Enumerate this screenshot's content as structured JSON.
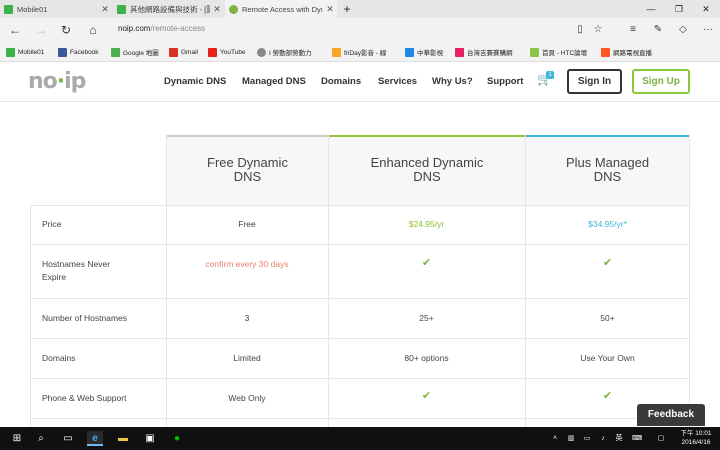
{
  "browser": {
    "tabs": [
      {
        "label": "Mobile01",
        "color": "#3cb34a"
      },
      {
        "label": "其他網路設備與技術 - [圖文",
        "color": "#3cb34a"
      },
      {
        "label": "Remote Access with Dyı",
        "color": "#7cb342"
      }
    ],
    "new_tab": "+",
    "url_host": "noip.com",
    "url_path": "/remote-access"
  },
  "favorites": [
    {
      "label": "Mobile01",
      "color": "#3cb34a"
    },
    {
      "label": "Facebook",
      "color": "#3b5998"
    },
    {
      "label": "Google 地圖",
      "color": "#4caf50"
    },
    {
      "label": "Gmail",
      "color": "#d93025"
    },
    {
      "label": "YouTube",
      "color": "#e62117"
    },
    {
      "label": "I 勞動部勞動力",
      "color": "#888888"
    },
    {
      "label": "friDay影音 - 線",
      "color": "#f5a623"
    },
    {
      "label": "中華影視",
      "color": "#1e88e5"
    },
    {
      "label": "台灣吉賽賽購網",
      "color": "#e91e63"
    },
    {
      "label": "首頁 - HTC論壇",
      "color": "#8bc34a"
    },
    {
      "label": "網路電視直播",
      "color": "#ff5722"
    }
  ],
  "site": {
    "logo_parts": [
      "no",
      "·",
      "ip"
    ],
    "nav": [
      "Dynamic DNS",
      "Managed DNS",
      "Domains",
      "Services",
      "Why Us?",
      "Support"
    ],
    "cart_count": "1",
    "signin": "Sign In",
    "signup": "Sign Up"
  },
  "pricing": {
    "columns": [
      {
        "title_line1": "Free Dynamic",
        "title_line2": "DNS",
        "accent": "#cccccc"
      },
      {
        "title_line1": "Enhanced Dynamic",
        "title_line2": "DNS",
        "accent": "#8dc63f"
      },
      {
        "title_line1": "Plus Managed",
        "title_line2": "DNS",
        "accent": "#3fb6d4"
      }
    ],
    "rows": [
      {
        "label": "Price",
        "values": [
          "Free",
          "$24.95/yr",
          "$34.95/yr*"
        ]
      },
      {
        "label_line1": "Hostnames Never",
        "label_line2": "Expire",
        "values": [
          "confirm every 30 days",
          "✔",
          "✔"
        ]
      },
      {
        "label": "Number of Hostnames",
        "values": [
          "3",
          "25+",
          "50+"
        ]
      },
      {
        "label": "Domains",
        "values": [
          "Limited",
          "80+ options",
          "Use Your Own"
        ]
      },
      {
        "label": "Phone & Web Support",
        "values": [
          "Web Only",
          "✔",
          "✔"
        ]
      }
    ],
    "colors": {
      "green_price": "#8dbf2f",
      "blue_price": "#3fb6d4",
      "warn": "#e8806f"
    }
  },
  "feedback": "Feedback",
  "taskbar": {
    "time": "下午 10:01",
    "date": "2016/4/16"
  }
}
